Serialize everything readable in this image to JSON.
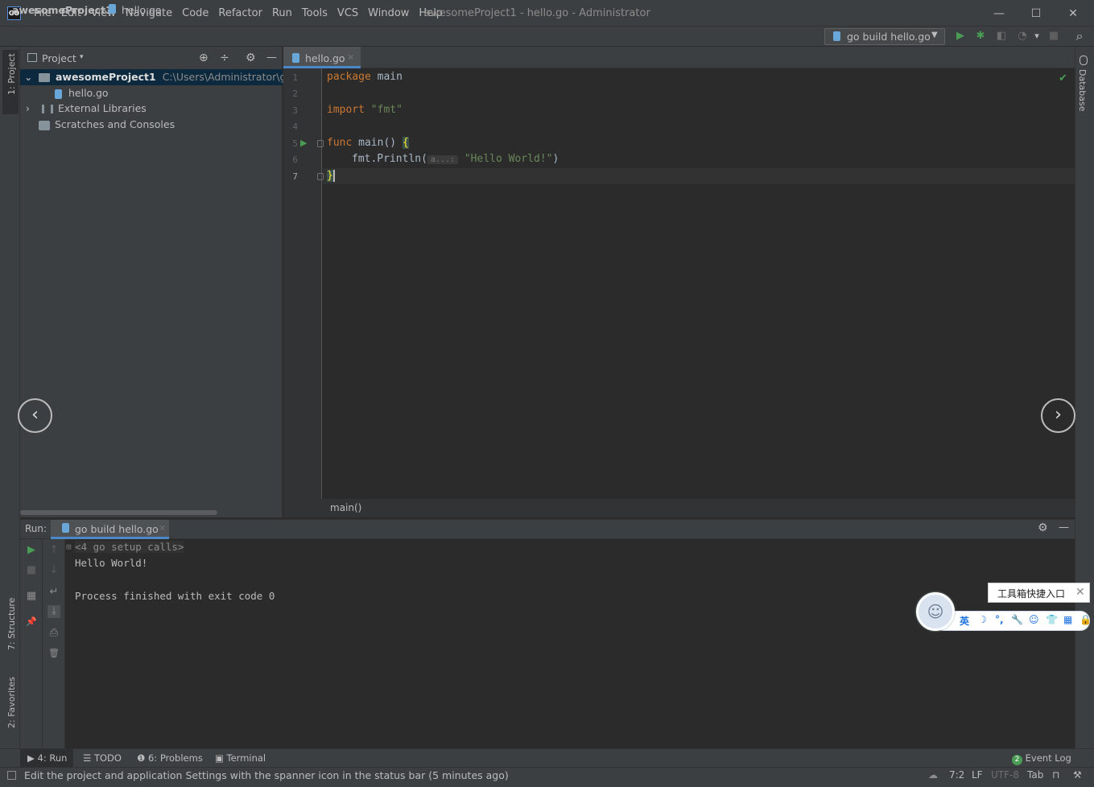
{
  "titlebar": {
    "logo": "GO",
    "menu": [
      "File",
      "Edit",
      "View",
      "Navigate",
      "Code",
      "Refactor",
      "Run",
      "Tools",
      "VCS",
      "Window",
      "Help"
    ],
    "window_title": "awesomeProject1 - hello.go - Administrator",
    "minimize": "—",
    "maximize": "☐",
    "close": "✕"
  },
  "navbar": {
    "project": "awesomeProject1",
    "separator": "›",
    "file": "hello.go",
    "run_config": "go build hello.go",
    "run_config_arrow": "▼",
    "icons": {
      "run": "▶",
      "debug": "✱",
      "coverage": "◧",
      "profile": "◔",
      "dropdown": "▾",
      "stop": "■",
      "search": "⌕"
    }
  },
  "left_stripe": {
    "project": "1: Project",
    "structure": "7: Structure",
    "favorites": "2: Favorites"
  },
  "right_stripe": {
    "database": "Database"
  },
  "project_panel": {
    "title": "Project",
    "arrow": "▾",
    "icons": {
      "locate": "⊕",
      "collapse": "÷",
      "settings": "⚙",
      "hide": "—"
    },
    "tree": {
      "root_name": "awesomeProject1",
      "root_path": "C:\\Users\\Administrator\\go\\src\\",
      "root_arrow": "⌄",
      "file": "hello.go",
      "external": "External Libraries",
      "external_arrow": "›",
      "scratches": "Scratches and Consoles"
    }
  },
  "editor": {
    "tab_label": "hello.go",
    "tab_close": "✕",
    "line_numbers": [
      "1",
      "2",
      "3",
      "4",
      "5",
      "6",
      "7"
    ],
    "code": {
      "l1_kw": "package",
      "l1_id": " main",
      "l3_kw": "import",
      "l3_str": " \"fmt\"",
      "l5_kw": "func",
      "l5_fn": " main()",
      "l5_brace": "{",
      "l6_call": "fmt.Println(",
      "l6_hint": "a...:",
      "l6_str": "\"Hello World!\"",
      "l6_close": ")",
      "l7_brace": "}"
    },
    "run_gutter": "▶",
    "ok_check": "✔",
    "breadcrumb": "main()"
  },
  "carousel": {
    "prev": "‹",
    "next": "›"
  },
  "run_panel": {
    "label": "Run:",
    "tab_label": "go build hello.go",
    "tab_close": "✕",
    "icons": {
      "settings": "⚙",
      "hide": "—",
      "rerun": "▶",
      "stop": "■",
      "layout": "▦",
      "pin": "📌",
      "up": "↑",
      "down": "↓",
      "wrap": "↵",
      "scroll_end": "⤓",
      "print": "⎙",
      "trash": "🗑"
    },
    "console": {
      "fold_marker": "⊞",
      "setup_calls": "<4 go setup calls>",
      "output": "Hello World!",
      "exit": "Process finished with exit code 0"
    }
  },
  "bottom_tools": {
    "run": "4: Run",
    "todo": "TODO",
    "problems": "6: Problems",
    "terminal": "Terminal",
    "event_log_count": "2",
    "event_log": "Event Log"
  },
  "statusbar": {
    "message": "Edit the project and application Settings with the spanner icon in the status bar (5 minutes ago)",
    "position": "7:2",
    "line_sep": "LF",
    "encoding": "UTF-8",
    "indent": "Tab"
  },
  "ime": {
    "tooltip": "工具箱快捷入口",
    "tooltip_close": "✕",
    "lang": "英",
    "icons": [
      "☽",
      "°,",
      "🔧",
      "☺",
      "👕",
      "▦",
      "🔒"
    ]
  }
}
